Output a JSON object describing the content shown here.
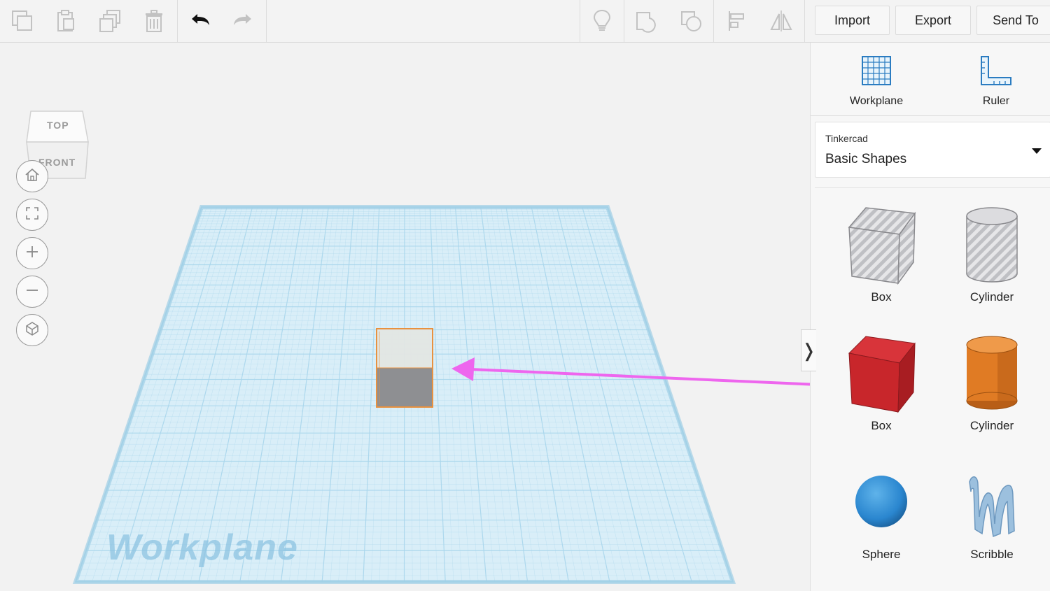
{
  "toolbar": {
    "icons": [
      "copy-icon",
      "paste-icon",
      "duplicate-icon",
      "delete-icon",
      "undo-icon",
      "redo-icon",
      "notes-icon",
      "group-icon",
      "ungroup-icon",
      "align-icon",
      "mirror-icon"
    ],
    "buttons": {
      "import": "Import",
      "export": "Export",
      "send_to": "Send To"
    }
  },
  "viewcube": {
    "top": "TOP",
    "front": "FRONT"
  },
  "nav": [
    "home-view-icon",
    "fit-all-icon",
    "zoom-in-icon",
    "zoom-out-icon",
    "perspective-icon"
  ],
  "workplane": {
    "watermark": "Workplane",
    "grid_color": "#a9d6ec",
    "selected_outline_color": "#e8913f"
  },
  "annotation": {
    "arrow_color": "#ee66ee"
  },
  "sidebar_toggle": "❭",
  "panel": {
    "tools": [
      {
        "label": "Workplane",
        "icon": "workplane-grid-icon"
      },
      {
        "label": "Ruler",
        "icon": "ruler-icon"
      }
    ],
    "library": {
      "provider": "Tinkercad",
      "category": "Basic Shapes"
    },
    "shapes": [
      {
        "label": "Box",
        "kind": "hole-box",
        "color": "#b7b7bb"
      },
      {
        "label": "Cylinder",
        "kind": "hole-cylinder",
        "color": "#b7b7bb"
      },
      {
        "label": "Box",
        "kind": "solid-box",
        "color": "#c8262b"
      },
      {
        "label": "Cylinder",
        "kind": "solid-cylinder",
        "color": "#e07b24"
      },
      {
        "label": "Sphere",
        "kind": "sphere",
        "color": "#2f8fd6"
      },
      {
        "label": "Scribble",
        "kind": "scribble",
        "color": "#8fb6d6"
      }
    ]
  }
}
